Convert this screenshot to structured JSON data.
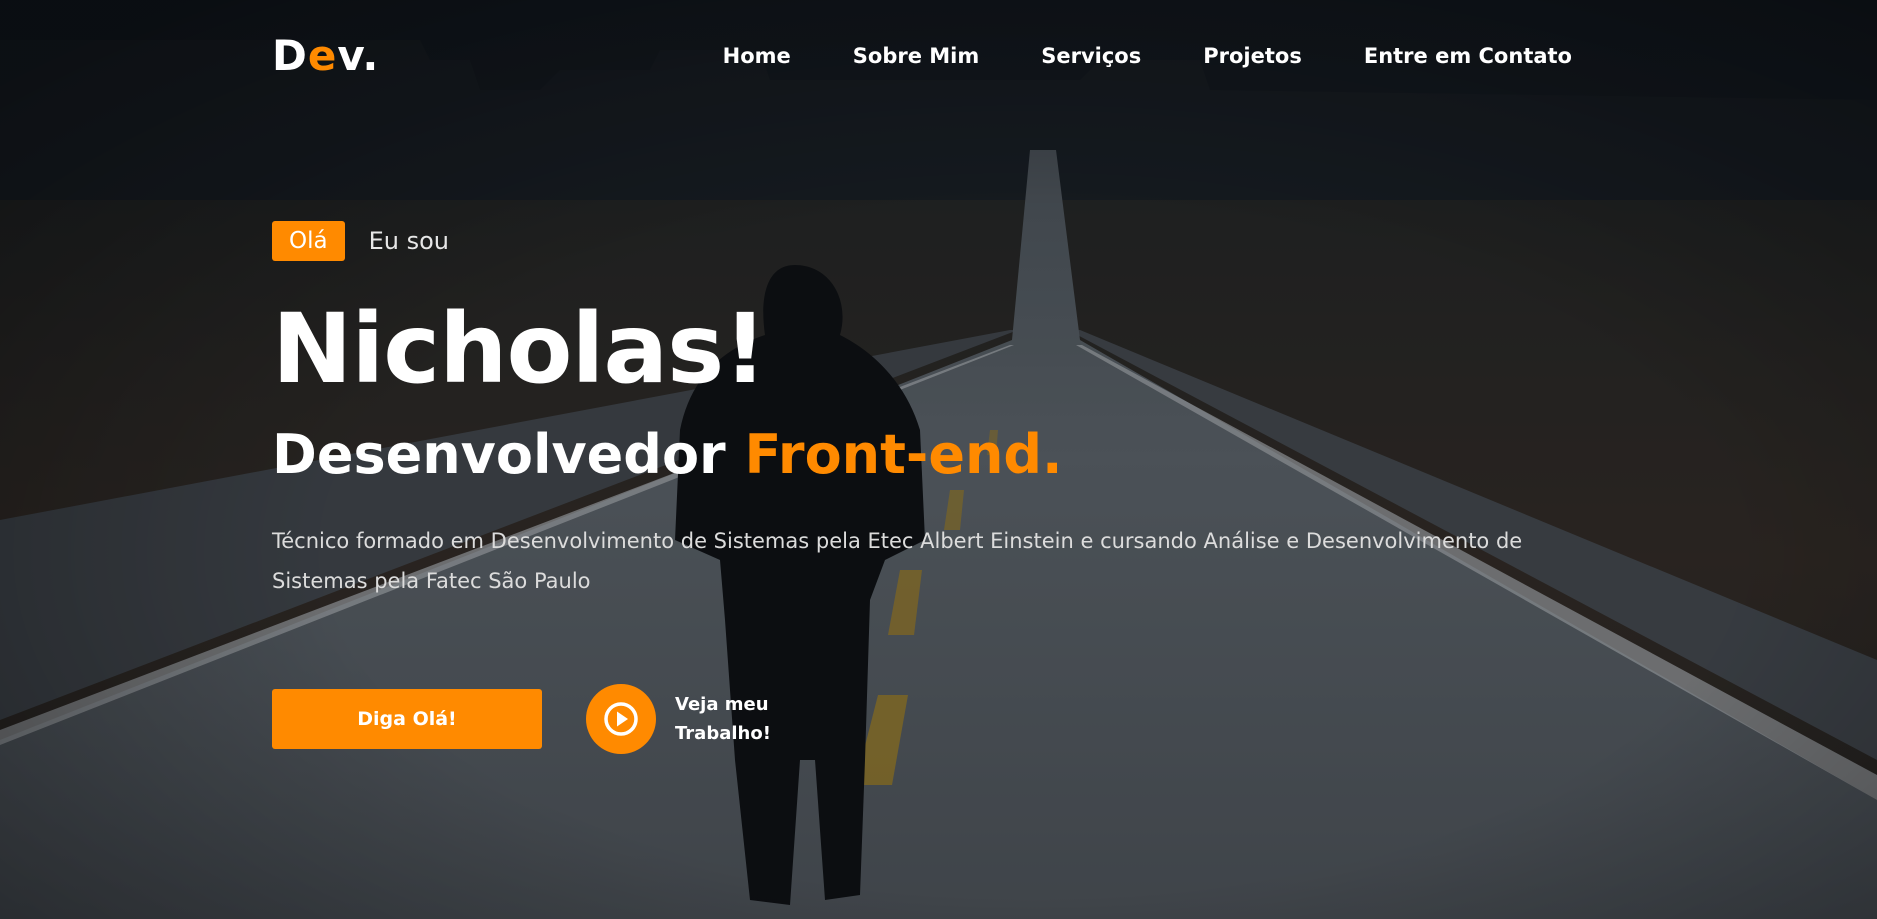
{
  "brand": {
    "logo_d": "D",
    "logo_e": "e",
    "logo_rest": "v.",
    "accent_color": "#ff8a00"
  },
  "nav": {
    "items": [
      {
        "label": "Home"
      },
      {
        "label": "Sobre Mim"
      },
      {
        "label": "Serviços"
      },
      {
        "label": "Projetos"
      },
      {
        "label": "Entre em Contato"
      }
    ]
  },
  "hero": {
    "badge": "Olá",
    "intro": "Eu sou",
    "name": "Nicholas!",
    "role_prefix": "Desenvolvedor",
    "role_accent": "Front-end.",
    "description": "Técnico formado em Desenvolvimento de Sistemas pela Etec Albert Einstein e cursando Análise e Desenvolvimento de Sistemas pela Fatec São Paulo",
    "cta_label": "Diga Olá!",
    "play_label_line1": "Veja meu",
    "play_label_line2": "Trabalho!",
    "play_icon": "play-circle-icon"
  }
}
